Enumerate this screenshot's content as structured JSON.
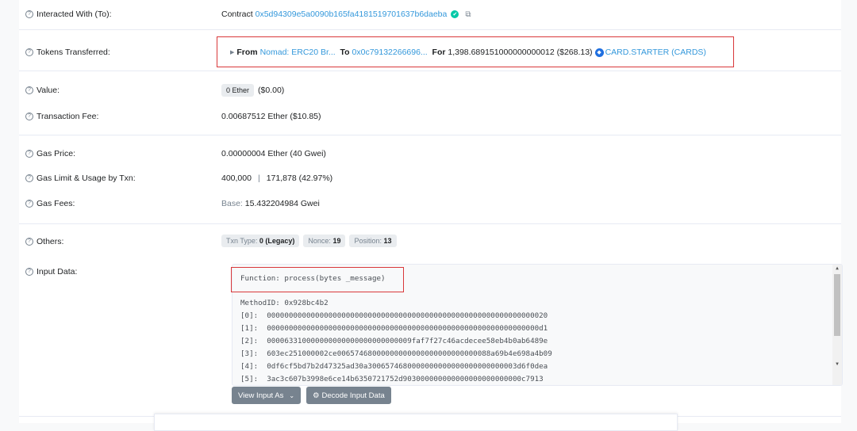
{
  "interacted": {
    "label": "Interacted With (To):",
    "prefix": "Contract",
    "address": "0x5d94309e5a0090b165fa4181519701637b6daeba"
  },
  "tokens": {
    "label": "Tokens Transferred:",
    "from_label": "From",
    "from_value": "Nomad: ERC20 Br...",
    "to_label": "To",
    "to_value": "0x0c79132266696...",
    "for_label": "For",
    "amount": "1,398.689151000000000012",
    "usd": "($268.13)",
    "token_name": "CARD.STARTER (CARDS)"
  },
  "value": {
    "label": "Value:",
    "badge": "0 Ether",
    "usd": "($0.00)"
  },
  "fee": {
    "label": "Transaction Fee:",
    "value": "0.00687512 Ether ($10.85)"
  },
  "gas_price": {
    "label": "Gas Price:",
    "value": "0.00000004 Ether (40 Gwei)"
  },
  "gas_limit": {
    "label": "Gas Limit & Usage by Txn:",
    "limit": "400,000",
    "sep": "|",
    "usage": "171,878 (42.97%)"
  },
  "gas_fees": {
    "label": "Gas Fees:",
    "base_label": "Base:",
    "base_value": "15.432204984 Gwei"
  },
  "others": {
    "label": "Others:",
    "txn_type_label": "Txn Type:",
    "txn_type_value": "0 (Legacy)",
    "nonce_label": "Nonce:",
    "nonce_value": "19",
    "position_label": "Position:",
    "position_value": "13"
  },
  "input": {
    "label": "Input Data:",
    "function": "Function: process(bytes _message)",
    "method_id": "MethodID: 0x928bc4b2",
    "params": [
      "[0]:  0000000000000000000000000000000000000000000000000000000000000020",
      "[1]:  00000000000000000000000000000000000000000000000000000000000000d1",
      "[2]:  000063310000000000000000000000009faf7f27c46acdecee58eb4b0ab6489e",
      "[3]:  603ec251000002ce00657468000000000000000000000000088a69b4e698a4b09",
      "[4]:  0df6cf5bd7b2d47325ad30a3006574680000000000000000000000003d6f0dea",
      "[5]:  3ac3c607b3998e6ce14b6350721752d903000000000000000000000000c7913"
    ],
    "view_btn": "View Input As",
    "decode_btn": "Decode Input Data"
  }
}
